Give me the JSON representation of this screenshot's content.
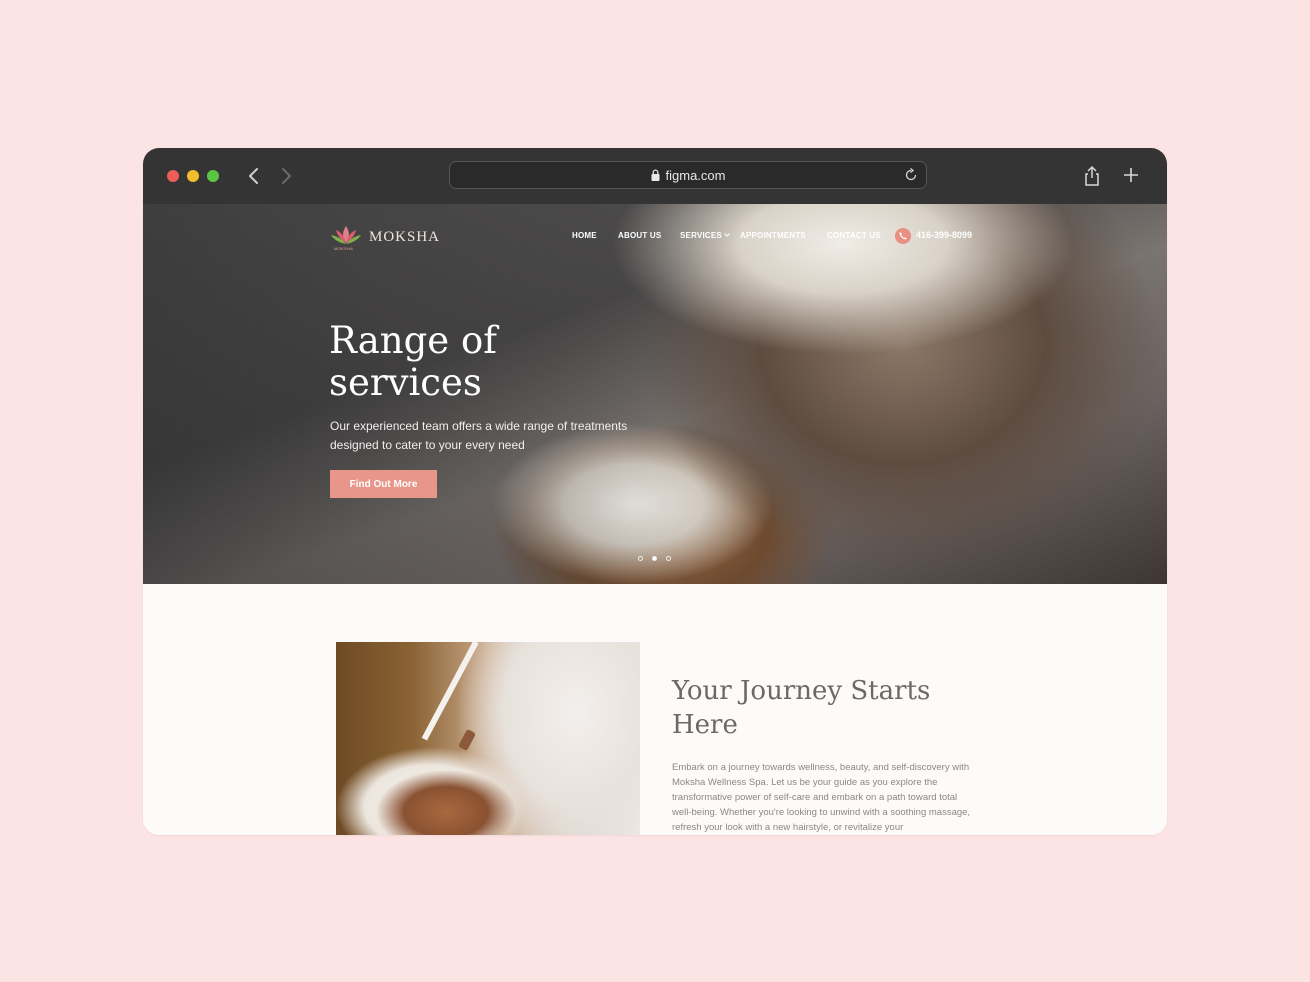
{
  "browser": {
    "url": "figma.com",
    "icons": [
      "close-dot",
      "minimize-dot",
      "zoom-dot",
      "back-arrow-icon",
      "forward-arrow-icon",
      "lock-icon",
      "reload-icon",
      "share-icon",
      "new-tab-icon"
    ]
  },
  "site": {
    "logo": {
      "name": "MOKSHA",
      "mark_caption": "MOKSHA"
    },
    "nav": {
      "home": "HOME",
      "about": "ABOUT US",
      "services": "SERVICES",
      "appointments": "APPOINTMENTS",
      "contact": "CONTACT US",
      "phone": "416-399-8099"
    },
    "hero": {
      "title_line1": "Range of",
      "title_line2": "services",
      "subtitle": "Our experienced team offers a wide range of treatments designed to cater to your every need",
      "button": "Find Out More",
      "carousel": {
        "count": 3,
        "active": 2
      }
    },
    "journey": {
      "title": "Your Journey Starts Here",
      "body": "Embark on a journey towards wellness, beauty, and self-discovery with Moksha Wellness Spa. Let us be your guide as you explore the transformative power of self-care and embark on a path toward total well-being. Whether you're looking to unwind with a soothing massage, refresh your look with a new hairstyle, or revitalize your"
    }
  },
  "colors": {
    "page_bg": "#fde4e4",
    "chrome": "#343434",
    "accent": "#e8958a",
    "traffic_red": "#ec5f57",
    "traffic_yellow": "#f1bd2f",
    "traffic_green": "#5cc443"
  }
}
